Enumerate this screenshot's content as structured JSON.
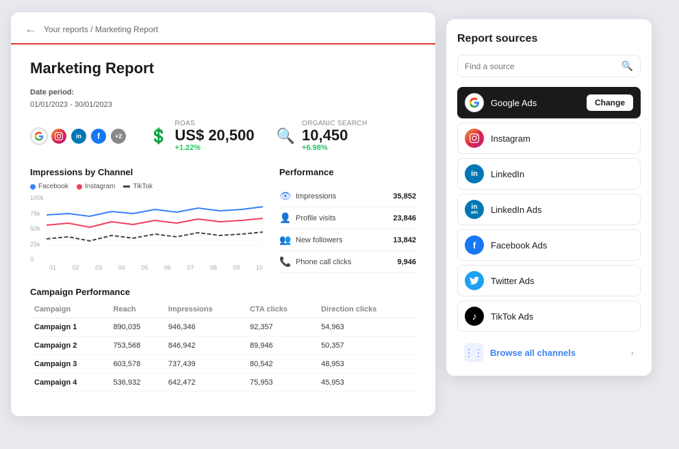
{
  "report": {
    "breadcrumb": "Your reports / Marketing Report",
    "back_icon": "←",
    "title": "Marketing Report",
    "date_period_label": "Date period:",
    "date_period_value": "01/01/2023 - 30/01/2023",
    "metrics": {
      "roas_label": "ROAS",
      "roas_value": "US$ 20,500",
      "roas_delta": "+1.22%",
      "organic_label": "Organic search",
      "organic_value": "10,450",
      "organic_delta": "+6.98%"
    },
    "channel_icons": [
      {
        "name": "Google Ads",
        "class": "icon-google",
        "text": "G"
      },
      {
        "name": "Instagram",
        "class": "icon-ig",
        "text": ""
      },
      {
        "name": "LinkedIn",
        "class": "icon-li",
        "text": "in"
      },
      {
        "name": "Facebook",
        "class": "icon-fb",
        "text": "f"
      },
      {
        "name": "extra",
        "class": "icon-extra",
        "text": "+2"
      }
    ],
    "chart": {
      "title": "Impressions by Channel",
      "legend": [
        {
          "label": "Facebook",
          "color": "#3b82f6"
        },
        {
          "label": "Instagram",
          "color": "#f43f5e"
        },
        {
          "label": "TikTok",
          "color": "#444"
        }
      ],
      "y_labels": [
        "100k",
        "75k",
        "50k",
        "25k",
        "0"
      ],
      "x_labels": [
        "01",
        "02",
        "03",
        "04",
        "05",
        "06",
        "07",
        "08",
        "09",
        "10"
      ]
    },
    "performance": {
      "title": "Performance",
      "rows": [
        {
          "icon": "👁",
          "label": "Impressions",
          "value": "35,852"
        },
        {
          "icon": "👤",
          "label": "Profile visits",
          "value": "23,846"
        },
        {
          "icon": "👥",
          "label": "New followers",
          "value": "13,842"
        },
        {
          "icon": "📞",
          "label": "Phone call clicks",
          "value": "9,946"
        }
      ]
    },
    "campaign": {
      "title": "Campaign Performance",
      "columns": [
        "Campaign",
        "Reach",
        "Impressions",
        "CTA clicks",
        "Direction clicks"
      ],
      "rows": [
        {
          "campaign": "Campaign 1",
          "reach": "890,035",
          "impressions": "946,346",
          "cta": "92,357",
          "direction": "54,963"
        },
        {
          "campaign": "Campaign 2",
          "reach": "753,568",
          "impressions": "846,942",
          "cta": "89,946",
          "direction": "50,357"
        },
        {
          "campaign": "Campaign 3",
          "reach": "603,578",
          "impressions": "737,439",
          "cta": "80,542",
          "direction": "48,953"
        },
        {
          "campaign": "Campaign 4",
          "reach": "536,932",
          "impressions": "642,472",
          "cta": "75,953",
          "direction": "45,953"
        }
      ]
    }
  },
  "sources_panel": {
    "title": "Report sources",
    "search_placeholder": "Find a source",
    "sources": [
      {
        "id": "google-ads",
        "name": "Google Ads",
        "class": "src-google",
        "text": "G",
        "active": true,
        "show_change": true
      },
      {
        "id": "instagram",
        "name": "Instagram",
        "class": "src-ig",
        "text": "📷",
        "active": false,
        "show_change": false
      },
      {
        "id": "linkedin",
        "name": "LinkedIn",
        "class": "src-li",
        "text": "in",
        "active": false,
        "show_change": false
      },
      {
        "id": "linkedin-ads",
        "name": "LinkedIn Ads",
        "class": "src-li-ads",
        "text": "in",
        "active": false,
        "show_change": false
      },
      {
        "id": "facebook-ads",
        "name": "Facebook Ads",
        "class": "src-fb",
        "text": "f",
        "active": false,
        "show_change": false
      },
      {
        "id": "twitter-ads",
        "name": "Twitter Ads",
        "class": "src-tw",
        "text": "🐦",
        "active": false,
        "show_change": false
      },
      {
        "id": "tiktok-ads",
        "name": "TikTok Ads",
        "class": "src-tiktok",
        "text": "♪",
        "active": false,
        "show_change": false
      }
    ],
    "change_label": "Change",
    "browse_label": "Browse all channels",
    "browse_chevron": "›"
  }
}
